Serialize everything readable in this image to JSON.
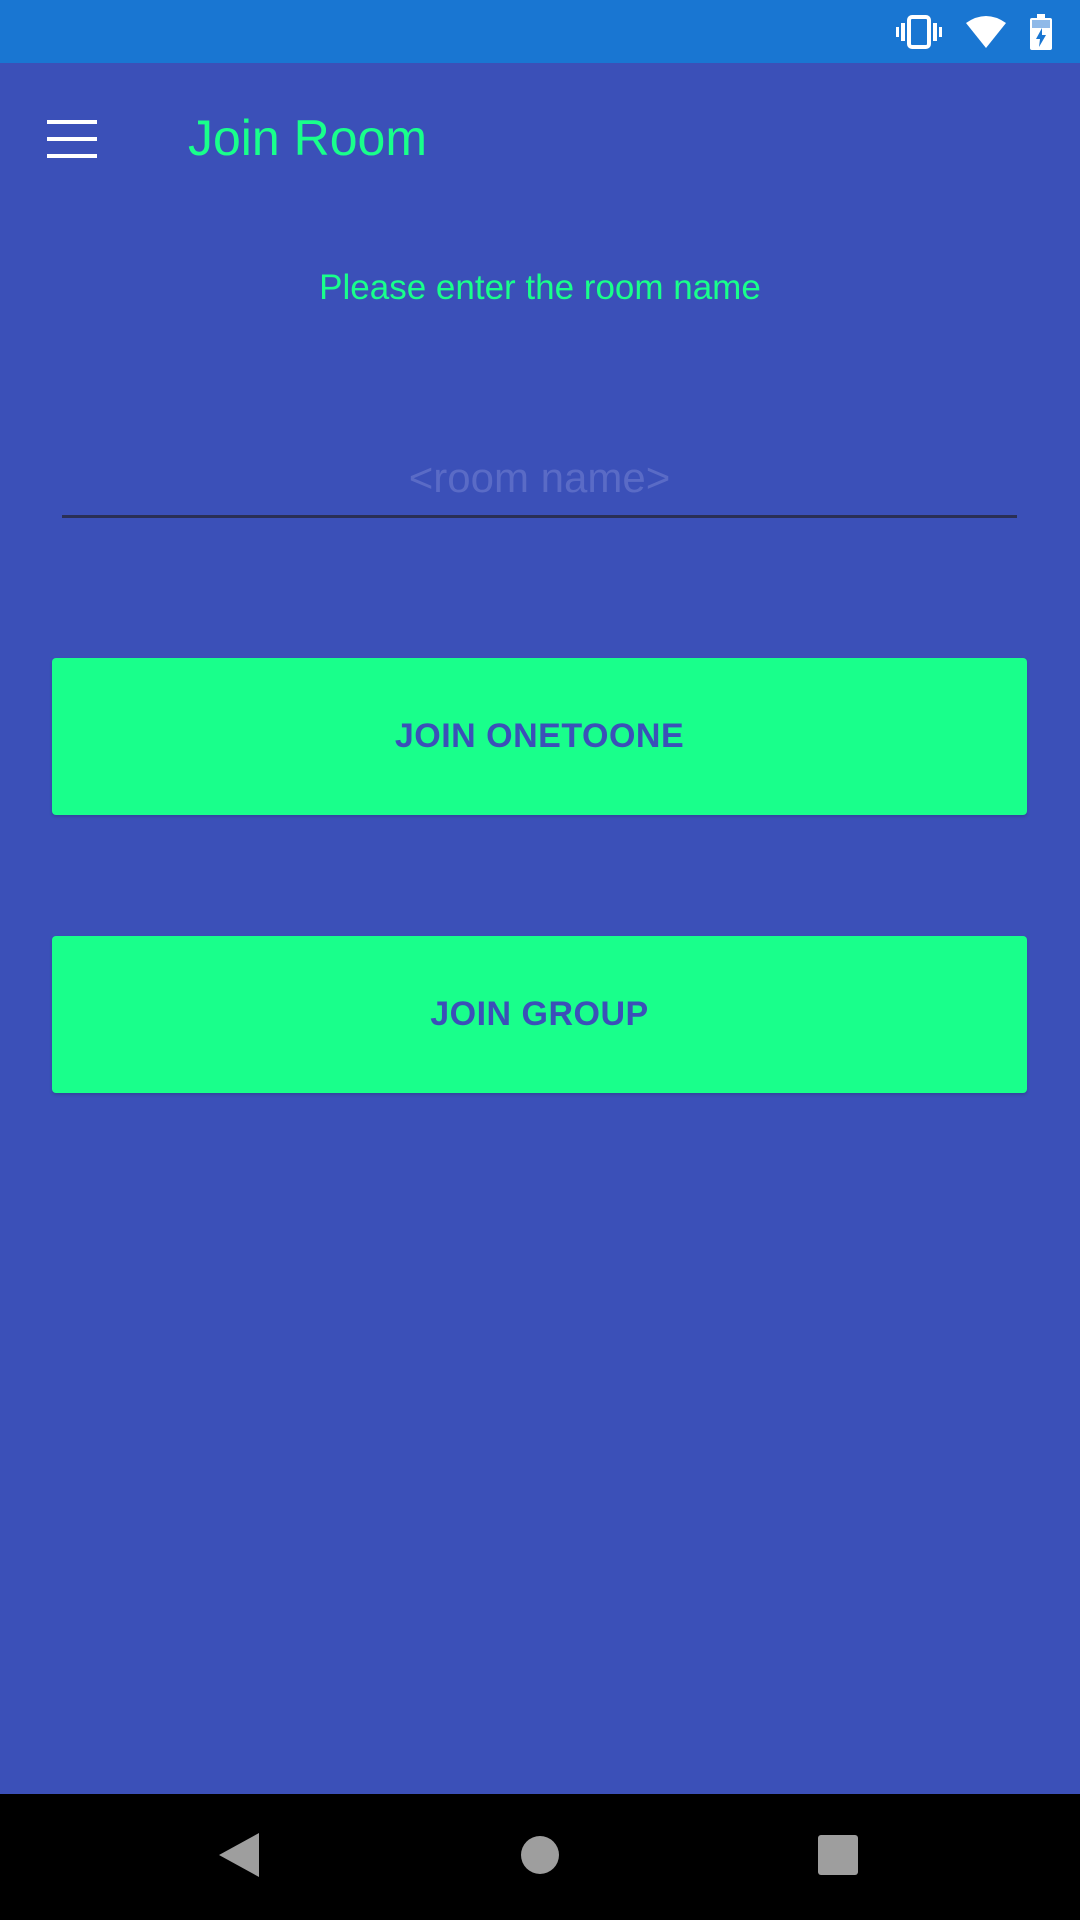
{
  "header": {
    "title": "Join Room",
    "menu_icon": "hamburger-menu-icon"
  },
  "main": {
    "instruction": "Please enter the room name",
    "room_input": {
      "value": "",
      "placeholder": "<room name>"
    },
    "buttons": {
      "join_onetoone": "JOIN ONETOONE",
      "join_group": "JOIN GROUP"
    }
  },
  "status_bar": {
    "icons": [
      "vibrate-icon",
      "wifi-icon",
      "battery-charging-icon"
    ]
  },
  "nav_bar": {
    "icons": [
      "back-icon",
      "home-icon",
      "recent-apps-icon"
    ]
  },
  "colors": {
    "status_bar": "#1976D2",
    "background": "#3B50B8",
    "accent": "#19FF8B",
    "nav_bar": "#000000"
  }
}
